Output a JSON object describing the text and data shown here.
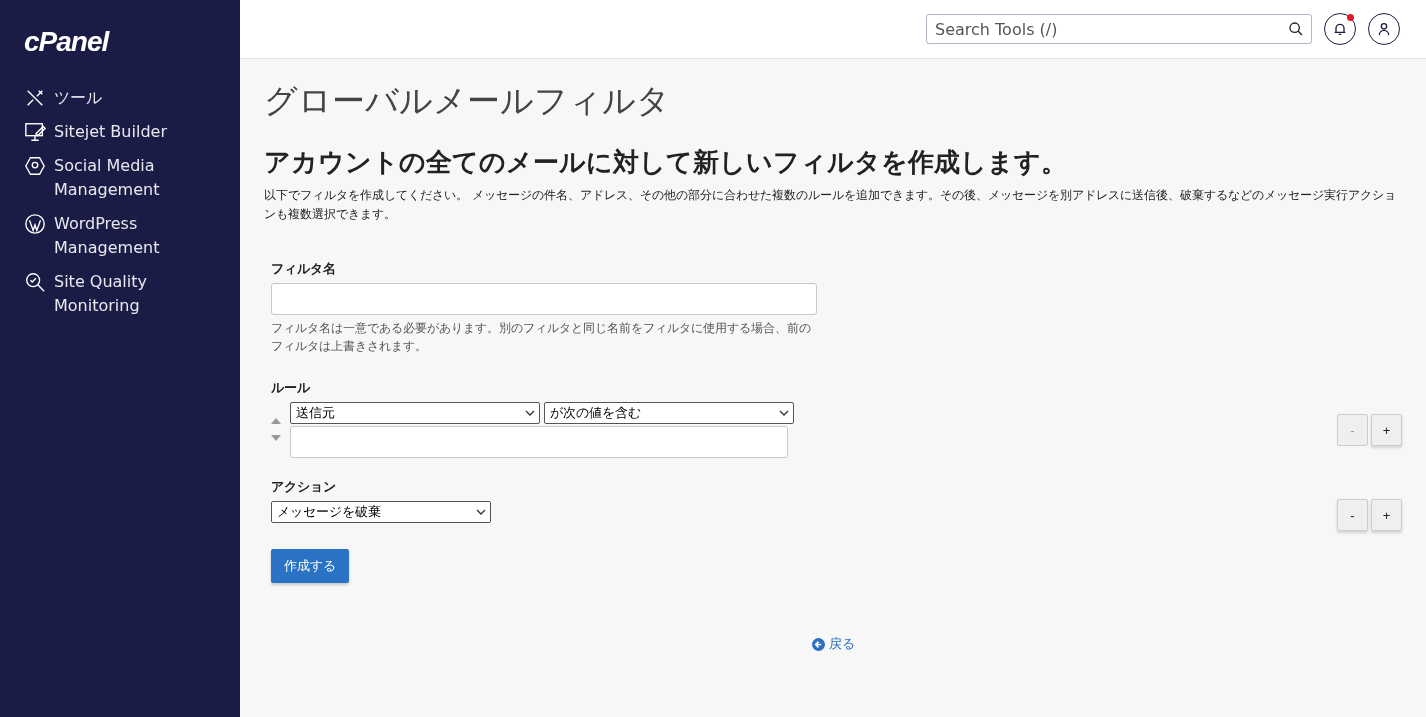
{
  "sidebar": {
    "logo": "cPanel",
    "items": [
      {
        "label": "ツール"
      },
      {
        "label": "Sitejet Builder"
      },
      {
        "label": "Social Media Management"
      },
      {
        "label": "WordPress Management"
      },
      {
        "label": "Site Quality Monitoring"
      }
    ]
  },
  "header": {
    "search": {
      "placeholder": "Search Tools (/)"
    },
    "notifications": {
      "unread": true
    }
  },
  "page": {
    "title": "グローバルメールフィルタ",
    "heading": "アカウントの全てのメールに対して新しいフィルタを作成します。",
    "description": "以下でフィルタを作成してください。 メッセージの件名、アドレス、その他の部分に合わせた複数のルールを追加できます。その後、メッセージを別アドレスに送信後、破棄するなどのメッセージ実行アクションも複数選択できます。"
  },
  "form": {
    "filter_name": {
      "label": "フィルタ名",
      "help": "フィルタ名は一意である必要があります。別のフィルタと同じ名前をフィルタに使用する場合、前のフィルタは上書きされます。"
    },
    "rules": {
      "label": "ルール",
      "part": "送信元",
      "condition": "が次の値を含む",
      "minus": {
        "label": "-",
        "disabled": true
      },
      "plus": {
        "label": "+",
        "disabled": false
      }
    },
    "actions": {
      "label": "アクション",
      "action": "メッセージを破棄",
      "minus": {
        "label": "-",
        "disabled": false
      },
      "plus": {
        "label": "+",
        "disabled": false
      }
    },
    "submit": "作成する"
  },
  "back_link": "戻る"
}
